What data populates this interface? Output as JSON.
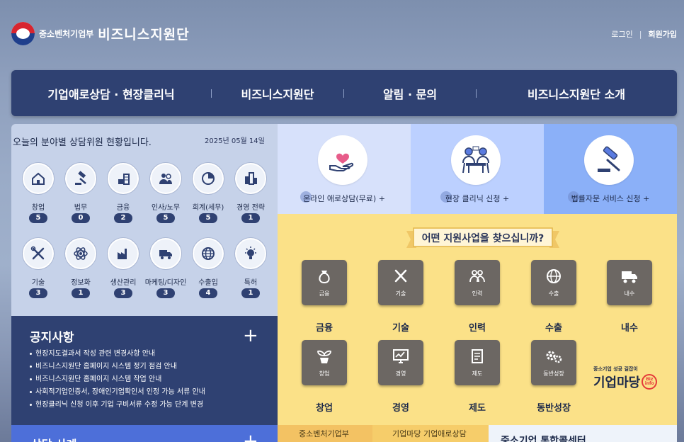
{
  "header": {
    "ministry": "중소벤처기업부",
    "brand": "비즈니스지원단",
    "login": "로그인",
    "signup": "회원가입"
  },
  "nav": {
    "items": [
      "기업애로상담 · 현장클리닉",
      "비즈니스지원단",
      "알림 · 문의",
      "비즈니스지원단 소개"
    ]
  },
  "status": {
    "title": "오늘의 분야별 상담위원 현황입니다.",
    "date": "2025년 05월 14일",
    "categories": [
      {
        "name": "창업",
        "count": "5",
        "icon": "house-icon"
      },
      {
        "name": "법무",
        "count": "0",
        "icon": "gavel-icon"
      },
      {
        "name": "금융",
        "count": "2",
        "icon": "coins-icon"
      },
      {
        "name": "인사/노무",
        "count": "5",
        "icon": "people-icon"
      },
      {
        "name": "회계(세무)",
        "count": "5",
        "icon": "pie-chart-icon"
      },
      {
        "name": "경영 전략",
        "count": "1",
        "icon": "buildings-icon"
      },
      {
        "name": "기술",
        "count": "3",
        "icon": "tools-icon"
      },
      {
        "name": "정보화",
        "count": "1",
        "icon": "atom-icon"
      },
      {
        "name": "생산관리",
        "count": "3",
        "icon": "factory-icon"
      },
      {
        "name": "마케팅/디자인",
        "count": "3",
        "icon": "truck-icon"
      },
      {
        "name": "수출입",
        "count": "4",
        "icon": "globe-icon"
      },
      {
        "name": "특허",
        "count": "1",
        "icon": "lightbulb-icon"
      }
    ]
  },
  "notice": {
    "title": "공지사항",
    "plus": "+",
    "items": [
      "현장지도결과서 작성 관련 변경사항 안내",
      "비즈니스지원단 홈페이지 시스템 정기 점검 안내",
      "비즈니스지원단 홈페이지 시스템 작업 안내",
      "사회적기업인증서, 장애인기업확인서 인정 가능 서류 안내",
      "현장클리닉 신청 이후 기업 구비서류 수정 가능 단계 변경"
    ]
  },
  "cases": {
    "title": "상담 사례",
    "plus": "+"
  },
  "services": [
    {
      "label": "온라인 애로상담(무료) +",
      "icon": "heart-hand-icon"
    },
    {
      "label": "현장 클리닉 신청 +",
      "icon": "meeting-icon"
    },
    {
      "label": "법률자문 서비스 신청 +",
      "icon": "gavel-icon"
    }
  ],
  "finder": {
    "title": "어떤 지원사업을 찾으십니까?",
    "tiles": [
      {
        "small": "금융",
        "label": "금융",
        "icon": "money-bag-icon"
      },
      {
        "small": "기술",
        "label": "기술",
        "icon": "tools-icon"
      },
      {
        "small": "인력",
        "label": "인력",
        "icon": "people-icon"
      },
      {
        "small": "수출",
        "label": "수출",
        "icon": "globe-icon"
      },
      {
        "small": "내수",
        "label": "내수",
        "icon": "truck-icon"
      },
      {
        "small": "창업",
        "label": "창업",
        "icon": "sprout-icon"
      },
      {
        "small": "경영",
        "label": "경영",
        "icon": "chart-monitor-icon"
      },
      {
        "small": "제도",
        "label": "제도",
        "icon": "document-icon"
      },
      {
        "small": "동반성장",
        "label": "동반성장",
        "icon": "gears-icon"
      }
    ],
    "madang_tagline": "중소기업 성공 길잡이",
    "madang_name": "기업마당",
    "madang_badge": "Biz info"
  },
  "bottom": {
    "left": "중소벤처기업부",
    "middle": "기업마당 기업애로상담",
    "right": "중소기업 통합콜센터"
  },
  "colors": {
    "nav": "#2f4172",
    "status_bg": "#c6d2e9",
    "finder_bg": "#fbe188",
    "accent_blue": "#4d6fd9"
  }
}
